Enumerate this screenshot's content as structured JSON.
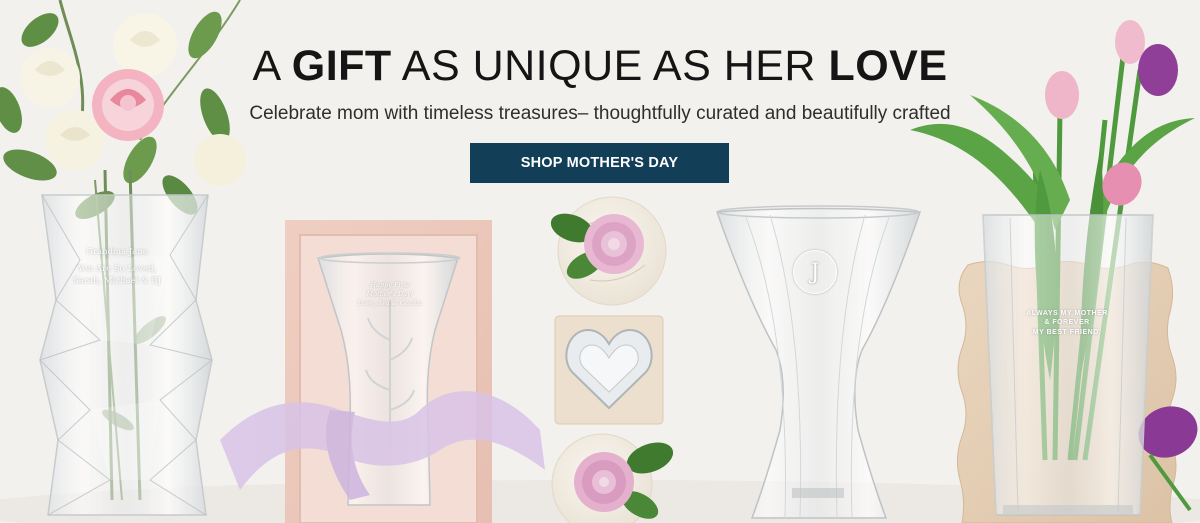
{
  "hero": {
    "headline_1": "A",
    "headline_2": "GIFT",
    "headline_3": "AS UNIQUE AS HER",
    "headline_4": "LOVE",
    "subheadline": "Celebrate mom with timeless treasures– thoughtfully curated and beautifully crafted",
    "cta_label": "SHOP MOTHER'S DAY"
  },
  "products": {
    "vase_left_line_1": "Grandma Jane",
    "vase_left_line_2": "You Are So Loved,",
    "vase_left_line_3": "Sarah, Michael & RJ",
    "frame_vase_line_1": "Happy First",
    "frame_vase_line_2": "Mother's Day!",
    "frame_vase_line_3": "Love, Ava & Cecilia",
    "hourglass_monogram": "J",
    "square_vase_line_1": "ALWAYS MY MOTHER",
    "square_vase_line_2": "& FOREVER",
    "square_vase_line_3": "MY BEST FRIEND."
  },
  "colors": {
    "cta_background": "#123e57",
    "cta_text": "#ffffff",
    "headline_text": "#151515",
    "background": "#f3f1ee"
  }
}
